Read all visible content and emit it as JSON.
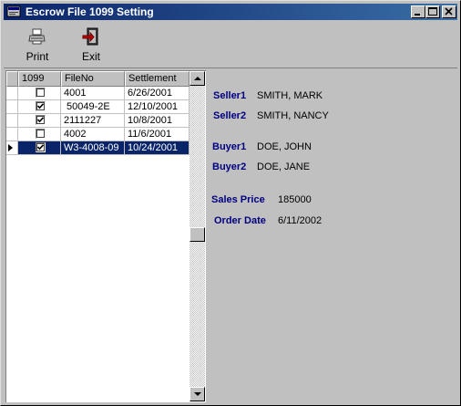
{
  "window": {
    "title": "Escrow File 1099 Setting",
    "controls": {
      "minimize": "_",
      "maximize": "□",
      "close": "×"
    }
  },
  "toolbar": {
    "print_label": "Print",
    "exit_label": "Exit"
  },
  "grid": {
    "columns": [
      "1099",
      "FileNo",
      "Settlement"
    ],
    "rows": [
      {
        "checked": false,
        "file_no": "4001",
        "settlement": "6/26/2001",
        "selected": false
      },
      {
        "checked": true,
        "file_no": " 50049-2E",
        "settlement": "12/10/2001",
        "selected": false
      },
      {
        "checked": true,
        "file_no": "2111227",
        "settlement": "10/8/2001",
        "selected": false
      },
      {
        "checked": false,
        "file_no": "4002",
        "settlement": "11/6/2001",
        "selected": false
      },
      {
        "checked": true,
        "file_no": "W3-4008-09",
        "settlement": "10/24/2001",
        "selected": true
      }
    ]
  },
  "details": {
    "seller1_label": "Seller1",
    "seller1_value": "SMITH, MARK",
    "seller2_label": "Seller2",
    "seller2_value": "SMITH, NANCY",
    "buyer1_label": "Buyer1",
    "buyer1_value": "DOE, JOHN",
    "buyer2_label": "Buyer2",
    "buyer2_value": "DOE, JANE",
    "sales_price_label": "Sales Price",
    "sales_price_value": "185000",
    "order_date_label": "Order Date",
    "order_date_value": "6/11/2002"
  },
  "colors": {
    "title_start": "#0a246a",
    "title_end": "#3a6ea5",
    "label_text": "#000080",
    "selection": "#0a246a"
  }
}
